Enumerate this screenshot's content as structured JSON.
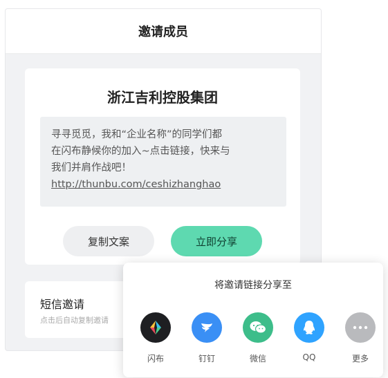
{
  "header": {
    "title": "邀请成员"
  },
  "card": {
    "org_name": "浙江吉利控股集团",
    "message": {
      "line1": "寻寻觅觅，我和“企业名称”的同学们都",
      "line2": "在闪布静候你的加入~点击链接，快来与",
      "line3": "我们并肩作战吧！",
      "link": "http://thunbu.com/ceshizhanghao"
    },
    "copy_button": "复制文案",
    "share_button": "立即分享"
  },
  "sms": {
    "title": "短信邀请",
    "subtitle": "点击后自动复制邀请"
  },
  "share_sheet": {
    "title": "将邀请链接分享至",
    "targets": [
      {
        "label": "闪布",
        "icon": "shanbu-icon",
        "color": "#1e1f22"
      },
      {
        "label": "钉钉",
        "icon": "dingtalk-icon",
        "color": "#3a8ff5"
      },
      {
        "label": "微信",
        "icon": "wechat-icon",
        "color": "#3dbd8a"
      },
      {
        "label": "QQ",
        "icon": "qq-icon",
        "color": "#2fa3ff"
      },
      {
        "label": "更多",
        "icon": "more-icon",
        "color": "#b9babd"
      }
    ]
  }
}
